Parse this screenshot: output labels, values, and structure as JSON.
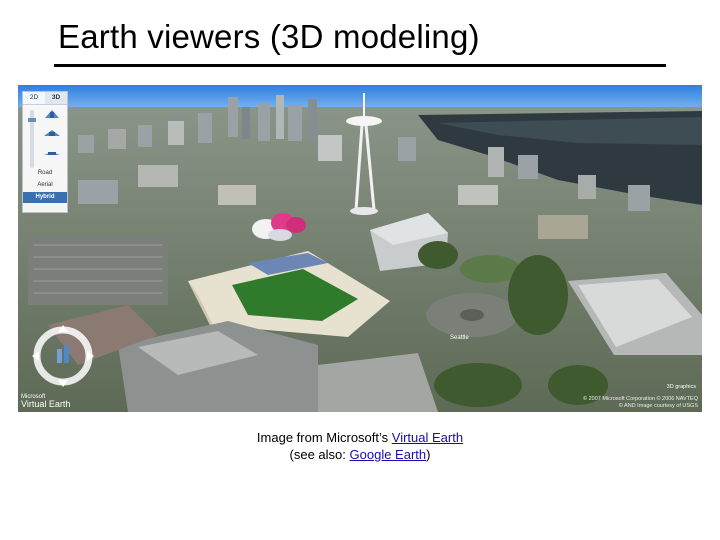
{
  "slide": {
    "title": "Earth viewers (3D modeling)"
  },
  "viewer": {
    "mode_tabs": [
      {
        "label": "2D",
        "active": false
      },
      {
        "label": "3D",
        "active": true
      }
    ],
    "map_styles": [
      {
        "label": "Road",
        "active": false
      },
      {
        "label": "Aerial",
        "active": false
      },
      {
        "label": "Hybrid",
        "active": true
      }
    ],
    "brand_small": "Microsoft",
    "brand_large": "Virtual Earth",
    "place_label": "Seattle",
    "credit": "3D graphics",
    "copyright_line1": "© 2007 Microsoft Corporation  © 2006 NAVTEQ",
    "copyright_line2": "© AND  Image courtesy of USGS"
  },
  "caption": {
    "line1_prefix": "Image from Microsoft’s ",
    "line1_link": "Virtual Earth",
    "line2_prefix": "(see also:  ",
    "line2_link": "Google Earth",
    "line2_suffix": ")"
  }
}
